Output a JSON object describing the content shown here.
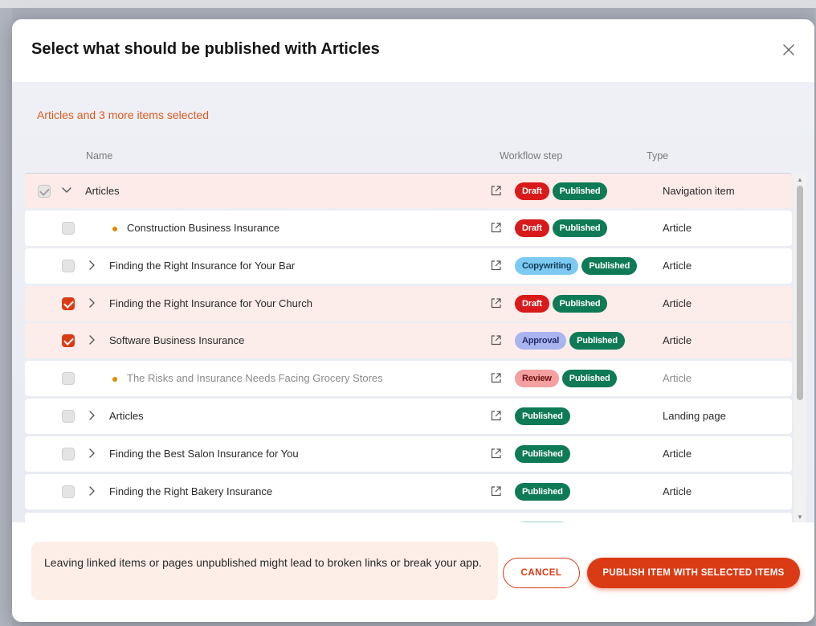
{
  "modal": {
    "title": "Select what should be published with Articles",
    "close_icon": "close-icon"
  },
  "selection": {
    "summary": "Articles and 3 more items selected"
  },
  "columns": {
    "name": "Name",
    "workflow": "Workflow step",
    "type": "Type"
  },
  "rows": [
    {
      "name": "Articles",
      "badges": [
        "Draft",
        "Published"
      ],
      "type": "Navigation item",
      "checked": true,
      "disabled": true,
      "expanded": true,
      "bullet": false
    },
    {
      "name": "Construction Business Insurance",
      "badges": [
        "Draft",
        "Published"
      ],
      "type": "Article",
      "checked": false,
      "bullet": true
    },
    {
      "name": "Finding the Right Insurance for Your Bar",
      "badges": [
        "Copywriting",
        "Published"
      ],
      "type": "Article",
      "checked": false,
      "bullet": false
    },
    {
      "name": "Finding the Right Insurance for Your Church",
      "badges": [
        "Draft",
        "Published"
      ],
      "type": "Article",
      "checked": true,
      "bullet": false
    },
    {
      "name": "Software Business Insurance",
      "badges": [
        "Approval",
        "Published"
      ],
      "type": "Article",
      "checked": true,
      "bullet": false
    },
    {
      "name": "The Risks and Insurance Needs Facing Grocery Stores",
      "badges": [
        "Review",
        "Published"
      ],
      "type": "Article",
      "checked": false,
      "bullet": true,
      "muted": true
    },
    {
      "name": "Articles",
      "badges": [
        "Published"
      ],
      "type": "Landing page",
      "checked": false,
      "bullet": false
    },
    {
      "name": "Finding the Best Salon Insurance for You",
      "badges": [
        "Published"
      ],
      "type": "Article",
      "checked": false,
      "bullet": false
    },
    {
      "name": "Finding the Right Bakery Insurance",
      "badges": [
        "Published"
      ],
      "type": "Article",
      "checked": false,
      "bullet": false
    }
  ],
  "colors": {
    "accent": "#db3b14",
    "draft": "#d91a1a",
    "published": "#0e7a56",
    "copywriting": "#7ccaf2",
    "approval": "#aab4ee",
    "review": "#f4a0a0",
    "selected_row": "#fcecea"
  },
  "footer": {
    "warning": "Leaving linked items or pages unpublished might lead to broken links or break your app.",
    "cancel_label": "CANCEL",
    "publish_label": "PUBLISH ITEM WITH SELECTED ITEMS"
  }
}
